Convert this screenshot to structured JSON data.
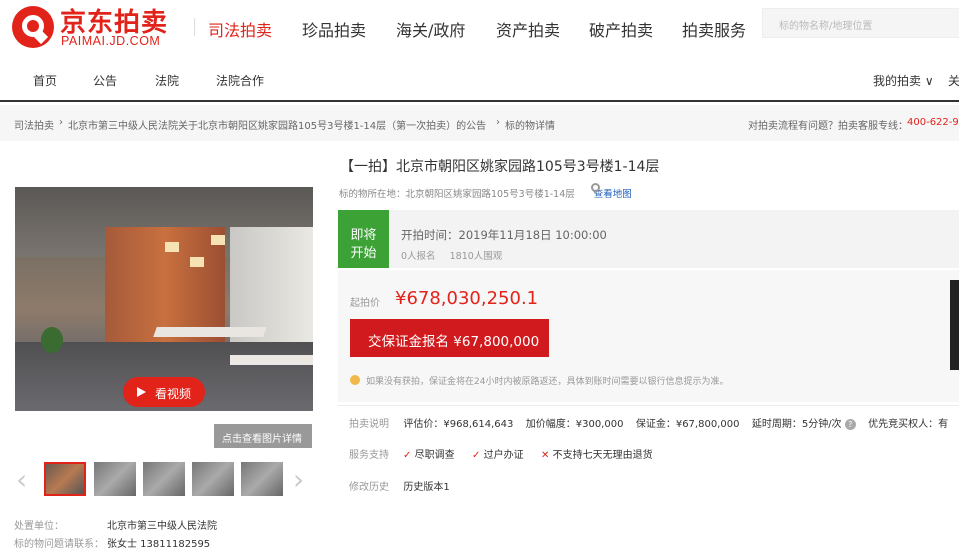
{
  "header": {
    "logo_cn": "京东拍卖",
    "logo_en": "PAIMAI.JD.COM",
    "nav": [
      "司法拍卖",
      "珍品拍卖",
      "海关/政府",
      "资产拍卖",
      "破产拍卖",
      "拍卖服务"
    ],
    "search_placeholder": "标的物名称/地理位置"
  },
  "subnav": {
    "items": [
      "首页",
      "公告",
      "法院",
      "法院合作"
    ],
    "my_auction": "我的拍卖 ∨",
    "more": "关"
  },
  "breadcrumb": {
    "level1": "司法拍卖",
    "level2": "北京市第三中级人民法院关于北京市朝阳区姚家园路105号3号楼1-14层（第一次拍卖）的公告",
    "level3": "标的物详情",
    "help_text": "对拍卖流程有问题？拍卖客服专线：",
    "phone": "400-622-9"
  },
  "gallery": {
    "video_label": "看视频",
    "detail_label": "点击查看图片详情",
    "prev": "‹",
    "next": "›",
    "thumb_count": 5
  },
  "disposal": {
    "unit_label": "处置单位：",
    "unit_value": "北京市第三中级人民法院",
    "contact_label": "标的物问题请联系：",
    "contact_value": "张女士  13811182595"
  },
  "item": {
    "title": "【一拍】北京市朝阳区姚家园路105号3号楼1-14层",
    "address_label": "标的物所在地：",
    "address": "北京朝阳区姚家园路105号3号楼1-14层",
    "map_link": "查看地图"
  },
  "status": {
    "tag_line1": "即将",
    "tag_line2": "开始",
    "start_time": "开拍时间：2019年11月18日 10:00:00",
    "signups": "0人报名",
    "watchers": "1810人围观"
  },
  "pricing": {
    "start_label": "起拍价",
    "start_price": "¥678,030,250.1",
    "deposit_button": "交保证金报名 ¥67,800,000",
    "tip": "如果没有获拍，保证金将在24小时内被原路返还，具体到账时间需要以银行信息提示为准。"
  },
  "details": {
    "label": "拍卖说明",
    "appraisal": "评估价：¥968,614,643",
    "increment": "加价幅度：¥300,000",
    "deposit": "保证金：¥67,800,000",
    "extension": "延时周期：5分钟/次",
    "priority": "优先竞买权人：有"
  },
  "support": {
    "label": "服务支持",
    "items": [
      "尽职调查",
      "过户办证",
      "不支持七天无理由退货"
    ],
    "marks": [
      "✓",
      "✓",
      "✕"
    ]
  },
  "history": {
    "label": "修改历史",
    "value": "历史版本1"
  },
  "colors": {
    "brand_red": "#e2231a",
    "status_green": "#3ca236",
    "link_blue": "#1f5fbf"
  }
}
